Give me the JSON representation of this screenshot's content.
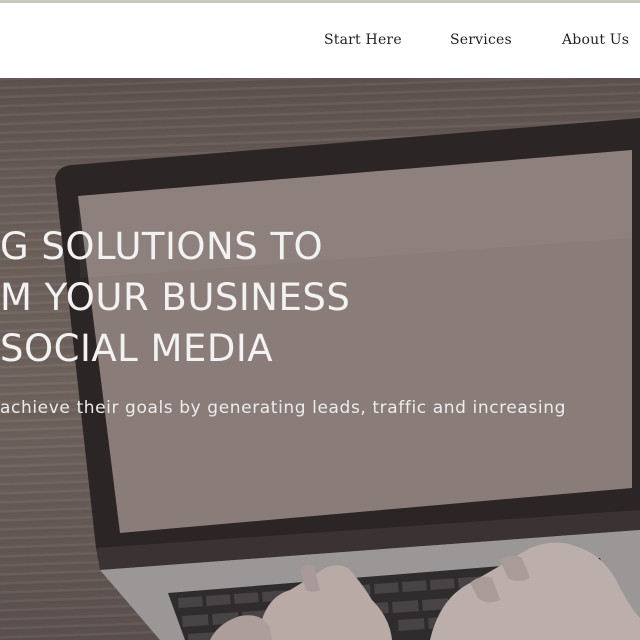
{
  "nav": {
    "items": [
      {
        "label": "Start Here"
      },
      {
        "label": "Services"
      },
      {
        "label": "About Us"
      }
    ]
  },
  "hero": {
    "headline_lines": [
      "G SOLUTIONS TO",
      "M YOUR BUSINESS",
      "SOCIAL MEDIA"
    ],
    "subheadline": "achieve their goals by generating leads, traffic and increasing"
  },
  "colors": {
    "nav_background": "#ffffff",
    "hero_overlay": "#6f625d",
    "headline_text": "#f2f2f2"
  }
}
